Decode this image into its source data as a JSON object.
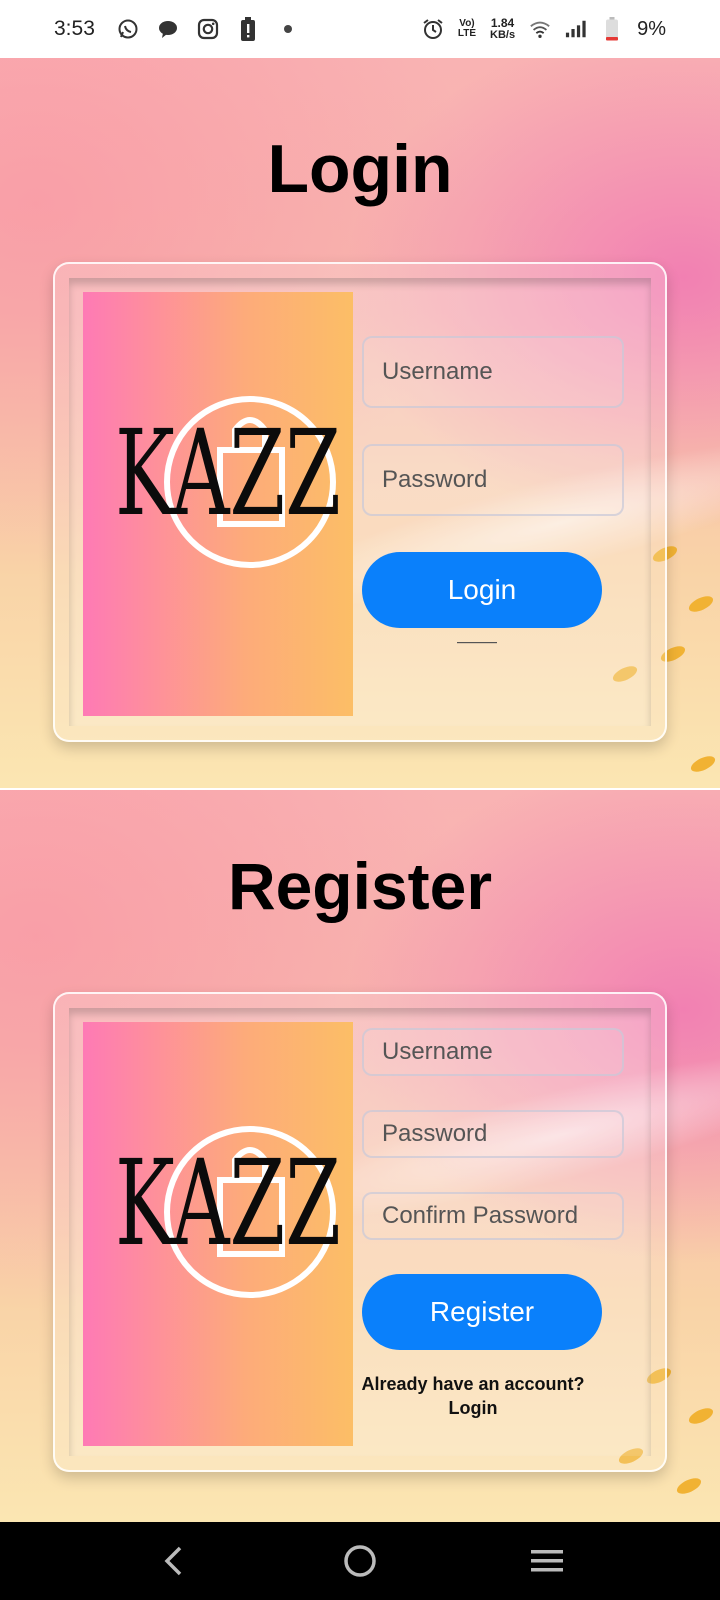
{
  "status_bar": {
    "time": "3:53",
    "network_speed_value": "1.84",
    "network_speed_unit": "KB/s",
    "volte_top": "Vo)",
    "volte_bottom": "LTE",
    "battery_percent": "9%",
    "icons": [
      "whatsapp-icon",
      "chat-bubble-icon",
      "instagram-icon",
      "battery-alert-icon",
      "dot-icon",
      "alarm-icon",
      "volte-icon",
      "wifi-icon",
      "signal-icon",
      "battery-icon"
    ]
  },
  "login": {
    "title": "Login",
    "logo_text": "KAZZ",
    "username_placeholder": "Username",
    "password_placeholder": "Password",
    "button_label": "Login"
  },
  "register": {
    "title": "Register",
    "logo_text": "KAZZ",
    "username_placeholder": "Username",
    "password_placeholder": "Password",
    "confirm_password_placeholder": "Confirm Password",
    "button_label": "Register",
    "already_text": "Already have an account?",
    "login_link": "Login"
  },
  "colors": {
    "accent_button": "#0a80fb",
    "logo_gradient_start": "#fe7ab5",
    "logo_gradient_end": "#fcbe66"
  },
  "nav_bar": {
    "icons": [
      "back-icon",
      "home-icon",
      "recents-icon"
    ]
  }
}
